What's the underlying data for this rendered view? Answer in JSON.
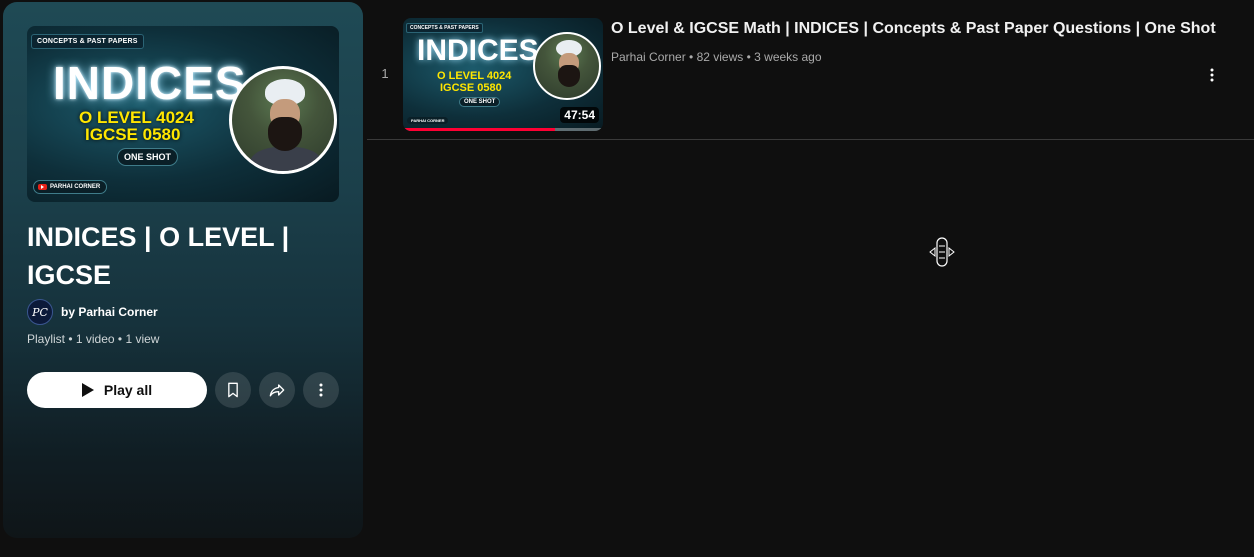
{
  "header": {
    "thumbnail": {
      "tag": "CONCEPTS & PAST PAPERS",
      "title": "INDICES",
      "line1": "O LEVEL 4024",
      "line2": "IGCSE 0580",
      "badge": "ONE SHOT",
      "brand": "PARHAI CORNER"
    },
    "title": "INDICES | O LEVEL | IGCSE",
    "owner": {
      "avatar_text": "PC",
      "label": "by Parhai Corner"
    },
    "meta": "Playlist • 1 video • 1 view",
    "play_all_label": "Play all",
    "icons": {
      "save": "bookmark-icon",
      "share": "share-icon",
      "more": "more-vert-icon"
    }
  },
  "videos": [
    {
      "index": "1",
      "title": "O Level & IGCSE Math | INDICES | Concepts & Past Paper Questions | One Shot",
      "channel": "Parhai Corner",
      "views": "82 views",
      "age": "3 weeks ago",
      "duration": "47:54",
      "watched_fraction": 0.76,
      "thumbnail": {
        "tag": "CONCEPTS & PAST PAPERS",
        "title": "INDICES",
        "line1": "O LEVEL 4024",
        "line2": "IGCSE 0580",
        "badge": "ONE SHOT",
        "brand": "PARHAI CORNER"
      }
    }
  ],
  "colors": {
    "accent_progress": "#ff0033",
    "background": "#0f0f0f",
    "panel": "#1f4a55"
  }
}
